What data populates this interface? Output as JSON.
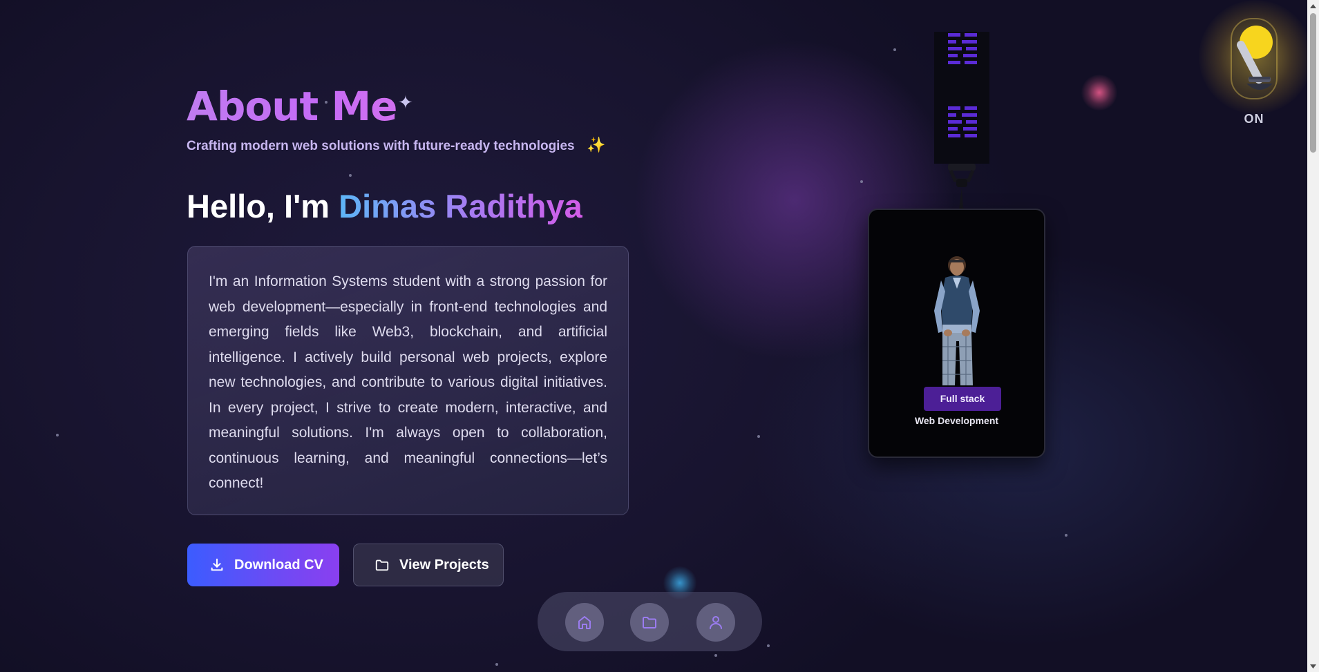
{
  "header": {
    "title": "About Me",
    "title_decoration_icon": "sparkle-icon",
    "subtitle": "Crafting modern web solutions with future-ready technologies",
    "subtitle_emoji": "✨"
  },
  "intro": {
    "greeting_prefix": "Hello, I'm",
    "name": "Dimas Radithya"
  },
  "bio": {
    "text": "I'm an Information Systems student with a strong passion for web development—especially in front-end technologies and emerging fields like Web3, blockchain, and artificial intelligence. I actively build personal web projects, explore new technologies, and contribute to various digital initiatives. In every project, I strive to create modern, interactive, and meaningful solutions. I'm always open to collaboration, continuous learning, and meaningful connections—let’s connect!"
  },
  "actions": {
    "download_cv": {
      "label": "Download CV",
      "icon": "download-icon"
    },
    "view_projects": {
      "label": "View Projects",
      "icon": "folder-icon"
    }
  },
  "id_card": {
    "role_badge": "Full stack",
    "role_subtitle": "Web Development"
  },
  "theme_toggle": {
    "state_label": "ON",
    "icon": "lamp-switch-icon"
  },
  "bottom_nav": {
    "items": [
      {
        "name": "home",
        "icon": "home-icon"
      },
      {
        "name": "projects",
        "icon": "folder-icon"
      },
      {
        "name": "about",
        "icon": "user-icon"
      }
    ]
  },
  "colors": {
    "accent_purple": "#c46bf5",
    "accent_blue": "#3b5cff",
    "background": "#18142f",
    "lamp_yellow": "#f7d51e",
    "badge_purple": "#4c1f96"
  }
}
